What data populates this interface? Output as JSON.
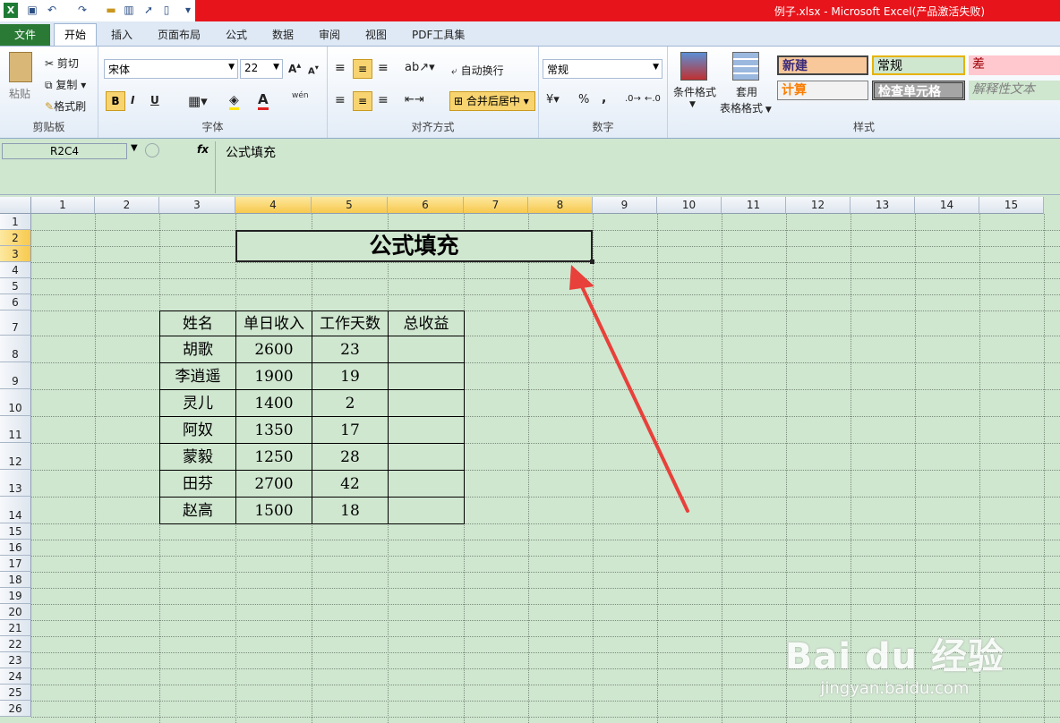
{
  "window": {
    "title": "例子.xlsx - Microsoft Excel(产品激活失败)"
  },
  "ribbon_tabs": [
    "文件",
    "开始",
    "插入",
    "页面布局",
    "公式",
    "数据",
    "审阅",
    "视图",
    "PDF工具集"
  ],
  "clipboard": {
    "paste": "粘贴",
    "cut": "剪切",
    "copy": "复制",
    "format_painter": "格式刷",
    "group": "剪贴板"
  },
  "font": {
    "name": "宋体",
    "size": "22",
    "bold": "B",
    "italic": "I",
    "underline": "U",
    "wen": "wén",
    "group": "字体"
  },
  "alignment": {
    "wrap": "自动换行",
    "merge": "合并后居中",
    "group": "对齐方式"
  },
  "number": {
    "format": "常规",
    "percent": "%",
    "comma": ",",
    "group": "数字"
  },
  "styles": {
    "conditional": "条件格式",
    "table_format_1": "套用",
    "table_format_2": "表格格式",
    "cells": [
      {
        "label": "新建",
        "bg": "#f8c89a"
      },
      {
        "label": "常规",
        "bg": "#cfe6cf"
      },
      {
        "label": "差",
        "bg": "#ffc7ce"
      },
      {
        "label": "计算",
        "bg": "#f2f2f2"
      },
      {
        "label": "检查单元格",
        "bg": "#a5a5a5"
      },
      {
        "label": "解释性文本",
        "bg": "#cfe6cf"
      }
    ],
    "group": "样式"
  },
  "formula_bar": {
    "name_box": "R2C4",
    "fx": "fx",
    "content": "公式填充"
  },
  "columns": [
    "1",
    "2",
    "3",
    "4",
    "5",
    "6",
    "7",
    "8",
    "9",
    "10",
    "11",
    "12",
    "13",
    "14",
    "15"
  ],
  "rows": [
    "1",
    "2",
    "3",
    "4",
    "5",
    "6",
    "7",
    "8",
    "9",
    "10",
    "11",
    "12",
    "13",
    "14",
    "15",
    "16",
    "17",
    "18",
    "19",
    "20",
    "21",
    "22",
    "23",
    "24",
    "25",
    "26"
  ],
  "sheet": {
    "title": "公式填充",
    "headers": [
      "姓名",
      "单日收入",
      "工作天数",
      "总收益"
    ],
    "records": [
      [
        "胡歌",
        "2600",
        "23",
        ""
      ],
      [
        "李逍遥",
        "1900",
        "19",
        ""
      ],
      [
        "灵儿",
        "1400",
        "2",
        ""
      ],
      [
        "阿奴",
        "1350",
        "17",
        ""
      ],
      [
        "蒙毅",
        "1250",
        "28",
        ""
      ],
      [
        "田芬",
        "2700",
        "42",
        ""
      ],
      [
        "赵高",
        "1500",
        "18",
        ""
      ]
    ]
  },
  "watermark": {
    "brand": "Bai du 经验",
    "url": "jingyan.baidu.com"
  },
  "colors": {
    "file_tab": "#2a7a35",
    "title_red": "#e8141b",
    "sheet_bg": "#cfe6cf",
    "annotation_arrow": "#e8403a"
  }
}
